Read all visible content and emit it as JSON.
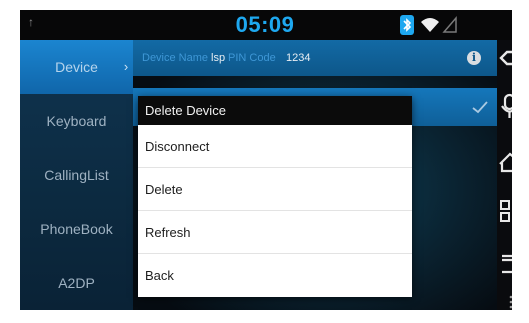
{
  "status_bar": {
    "time": "05:09",
    "usb_glyph": "↑",
    "icons": [
      "usb-icon",
      "bluetooth-icon",
      "wifi-icon",
      "signal-icon"
    ],
    "time_color": "#1ea8f0"
  },
  "sidebar": {
    "items": [
      {
        "label": "Device",
        "active": true
      },
      {
        "label": "Keyboard",
        "active": false
      },
      {
        "label": "CallingList",
        "active": false
      },
      {
        "label": "PhoneBook",
        "active": false
      },
      {
        "label": "A2DP",
        "active": false
      }
    ],
    "chevron": "›",
    "active_color": "#1b85d0"
  },
  "device_info": {
    "name_label": "Device Name",
    "name_value": "lsp",
    "pin_label": "PIN Code",
    "pin_value": "1234",
    "info_glyph": "i"
  },
  "dialog": {
    "title": "Delete Device",
    "options": [
      "Disconnect",
      "Delete",
      "Refresh",
      "Back"
    ]
  },
  "nav_bar": {
    "icons": [
      "back-icon",
      "microphone-icon",
      "home-icon",
      "recent-apps-icon",
      "window-icon"
    ]
  }
}
